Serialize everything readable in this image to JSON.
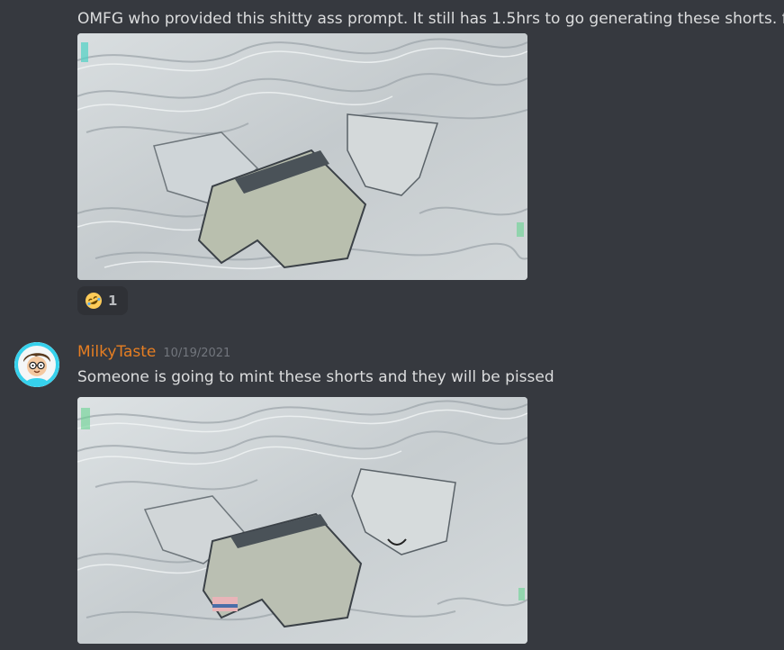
{
  "messages": [
    {
      "text": "OMFG who provided this shitty ass prompt. It still has 1.5hrs to go generating these shorts. ffs",
      "reactions": [
        {
          "emoji": "rolling-on-the-floor-laughing",
          "count": "1"
        }
      ]
    },
    {
      "author": "MilkyTaste",
      "timestamp": "10/19/2021",
      "author_color": "#e67e22",
      "text": "Someone is going to mint these shorts and they will be pissed"
    }
  ],
  "theme": {
    "background": "#36393f",
    "text": "#dcddde",
    "muted": "#72767d"
  }
}
